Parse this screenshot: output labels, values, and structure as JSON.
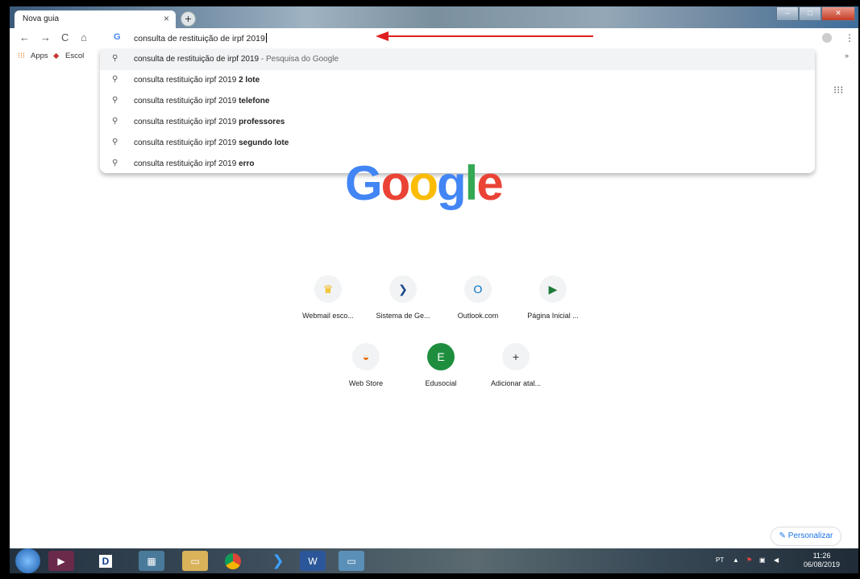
{
  "browser": {
    "tab_title": "Nova guia",
    "tab_close": "×",
    "new_tab": "+",
    "nav": {
      "back": "←",
      "forward": "→",
      "reload": "C",
      "home": "⌂"
    },
    "window_controls": {
      "minimize": "–",
      "maximize": "□",
      "close": "✕"
    }
  },
  "omnibox": {
    "g_mark": "G",
    "value": "consulta de restituição de irpf 2019"
  },
  "bookmarks": [
    {
      "label": "Apps",
      "icon": "apps-grid-icon"
    },
    {
      "label": "Escol",
      "icon": "bookmark-bird-icon"
    }
  ],
  "bookmarks_more": "»",
  "suggestions": [
    {
      "base": "consulta de restituição de irpf 2019",
      "bold": "",
      "sep": " - ",
      "suffix": "Pesquisa do Google",
      "selected": true
    },
    {
      "base": "consulta restituição irpf 2019 ",
      "bold": "2 lote",
      "sep": "",
      "suffix": "",
      "selected": false
    },
    {
      "base": "consulta restituição irpf 2019 ",
      "bold": "telefone",
      "sep": "",
      "suffix": "",
      "selected": false
    },
    {
      "base": "consulta restituição irpf 2019 ",
      "bold": "professores",
      "sep": "",
      "suffix": "",
      "selected": false
    },
    {
      "base": "consulta restituição irpf 2019 ",
      "bold": "segundo lote",
      "sep": "",
      "suffix": "",
      "selected": false
    },
    {
      "base": "consulta restituição irpf 2019 ",
      "bold": "erro",
      "sep": "",
      "suffix": "",
      "selected": false
    }
  ],
  "logo_colors": {
    "blue": "#4285f4",
    "red": "#ea4335",
    "yellow": "#fbbc05",
    "green": "#34a853"
  },
  "logo_text": {
    "g1": "G",
    "o1": "o",
    "o2": "o",
    "g2": "g",
    "l": "l",
    "e": "e"
  },
  "shortcuts": [
    {
      "label": "Webmail esco...",
      "icon": "crown-icon",
      "glyph": "♛"
    },
    {
      "label": "Sistema de Ge...",
      "icon": "chevron-logo-icon",
      "glyph": "❯"
    },
    {
      "label": "Outlook.com",
      "icon": "outlook-icon",
      "glyph": "O"
    },
    {
      "label": "Página Inicial ...",
      "icon": "flag-icon",
      "glyph": "▶"
    },
    {
      "label": "Web Store",
      "icon": "web-store-icon",
      "glyph": "◒"
    },
    {
      "label": "Edusocial",
      "icon": "edusocial-icon",
      "glyph": "E"
    },
    {
      "label": "Adicionar atal...",
      "icon": "add-icon",
      "glyph": "+"
    }
  ],
  "personalize": {
    "glyph": "✎",
    "label": "Personalizar"
  },
  "taskbar": {
    "lang": "PT",
    "time": "11:26",
    "date": "06/08/2019",
    "apps": [
      "D"
    ]
  }
}
